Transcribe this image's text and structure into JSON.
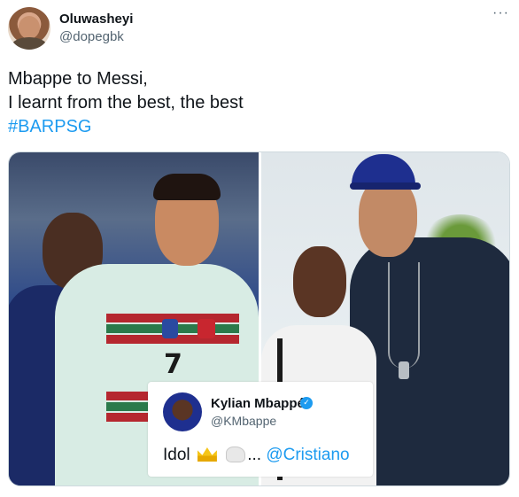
{
  "tweet": {
    "display_name": "Oluwasheyi",
    "handle": "@dopegbk",
    "more_icon": "more-horizontal-icon",
    "more_glyph": "···",
    "text_lines": [
      "Mbappe to Messi,",
      "I learnt from the best, the best"
    ],
    "hashtag": "#BARPSG"
  },
  "media": {
    "left_photo": {
      "jersey_number": "7"
    },
    "embedded_tweet": {
      "name": "Kylian Mbappé",
      "verified_icon": "verified-badge-icon",
      "verified_glyph": "✓",
      "handle": "@KMbappe",
      "text_before": "Idol",
      "emoji_1": "crown-icon",
      "emoji_2": "goat-icon",
      "ellipsis": "...",
      "mention": "@Cristiano"
    }
  },
  "colors": {
    "link": "#1d9bf0",
    "text": "#0f1419",
    "secondary": "#536471"
  }
}
